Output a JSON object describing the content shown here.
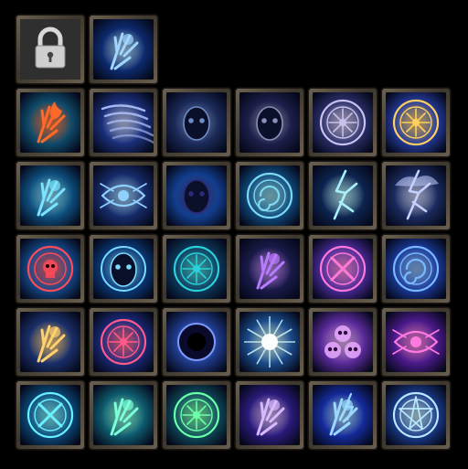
{
  "panel": "skill-icon-grid",
  "rows": [
    {
      "slots": [
        {
          "name": "skill-slot-locked",
          "icon": "padlock-icon",
          "state": "locked",
          "bg": "#3a3a3a",
          "glow": "#cfcfcf"
        },
        {
          "name": "skill-slot-summon-spirit",
          "icon": "glowing-hand-spirit-icon",
          "state": "unlocked",
          "bg": "#0d2a6e",
          "glow": "#9fd6ff"
        }
      ]
    },
    {
      "slots": [
        {
          "name": "skill-slot-fire-hand",
          "icon": "fire-in-hand-icon",
          "bg": "#0f4a6a",
          "glow": "#ff6a2a"
        },
        {
          "name": "skill-slot-whirlwind",
          "icon": "whirlwind-icon",
          "bg": "#1a2f7a",
          "glow": "#b7c8ff"
        },
        {
          "name": "skill-slot-dark-spirit",
          "icon": "dark-spirit-face-icon",
          "bg": "#1b2a5a",
          "glow": "#6d8cc8"
        },
        {
          "name": "skill-slot-shadow-knight",
          "icon": "shadow-knight-icon",
          "bg": "#1c1f4a",
          "glow": "#8a8fb8"
        },
        {
          "name": "skill-slot-spirit-rune",
          "icon": "spirit-rune-circle-icon",
          "bg": "#2a2f6a",
          "glow": "#c9c2ee"
        },
        {
          "name": "skill-slot-golden-sigil",
          "icon": "golden-sigil-icon",
          "bg": "#243a9a",
          "glow": "#ffd060"
        }
      ]
    },
    {
      "slots": [
        {
          "name": "skill-slot-ice-claw",
          "icon": "ice-claw-icon",
          "bg": "#0e4f7e",
          "glow": "#7be3ff"
        },
        {
          "name": "skill-slot-spirit-mage",
          "icon": "glowing-eyes-mage-icon",
          "bg": "#162b6b",
          "glow": "#8fd0ff"
        },
        {
          "name": "skill-slot-insect-totem",
          "icon": "insect-totem-icon",
          "bg": "#123e8e",
          "glow": "#2a2a7a"
        },
        {
          "name": "skill-slot-spiral-seal",
          "icon": "spiral-seal-icon",
          "bg": "#0f4a7e",
          "glow": "#7ed8f0"
        },
        {
          "name": "skill-slot-lightning",
          "icon": "lightning-icon",
          "bg": "#0d2450",
          "glow": "#a9f0ff"
        },
        {
          "name": "skill-slot-storm-cloud",
          "icon": "storm-cloud-icon",
          "bg": "#1a2a5e",
          "glow": "#c5d0ff"
        }
      ]
    },
    {
      "slots": [
        {
          "name": "skill-slot-crimson-sigil",
          "icon": "crimson-skull-sigil-icon",
          "bg": "#144a8a",
          "glow": "#ff4a5a"
        },
        {
          "name": "skill-slot-spirit-dancer",
          "icon": "spirit-dancer-orb-icon",
          "bg": "#0a3a7a",
          "glow": "#7ad8ff"
        },
        {
          "name": "skill-slot-knot-seal",
          "icon": "knot-seal-icon",
          "bg": "#0d3a5e",
          "glow": "#2bd0d8"
        },
        {
          "name": "skill-slot-shadow-grasp",
          "icon": "shadow-grasp-icon",
          "bg": "#1a1a4a",
          "glow": "#b87aff"
        },
        {
          "name": "skill-slot-arcane-cross",
          "icon": "arcane-cross-circle-icon",
          "bg": "#4a2a9a",
          "glow": "#ff7ad8"
        },
        {
          "name": "skill-slot-vortex",
          "icon": "vortex-icon",
          "bg": "#1a3a9a",
          "glow": "#7ab8ff"
        }
      ]
    },
    {
      "slots": [
        {
          "name": "skill-slot-light-finger",
          "icon": "glowing-finger-icon",
          "bg": "#1a2f6a",
          "glow": "#ffd070"
        },
        {
          "name": "skill-slot-runic-circle",
          "icon": "runic-circle-icon",
          "bg": "#1a2a7a",
          "glow": "#ff5a8a"
        },
        {
          "name": "skill-slot-void-portal",
          "icon": "void-portal-icon",
          "bg": "#1e3a8a",
          "glow": "#7a9aff"
        },
        {
          "name": "skill-slot-starburst",
          "icon": "starburst-icon",
          "bg": "#1a4a8a",
          "glow": "#d8ffff"
        },
        {
          "name": "skill-slot-triple-skull",
          "icon": "triple-skull-icon",
          "bg": "#5a2a9a",
          "glow": "#e8a8ff"
        },
        {
          "name": "skill-slot-all-seeing-eye",
          "icon": "winged-eye-icon",
          "bg": "#4a1a8a",
          "glow": "#ff7ae0"
        }
      ]
    },
    {
      "slots": [
        {
          "name": "skill-slot-crossed-seal",
          "icon": "crossed-seal-icon",
          "bg": "#0a4a7a",
          "glow": "#6af0ff"
        },
        {
          "name": "skill-slot-spirit-palm",
          "icon": "spirit-palm-icon",
          "bg": "#0e5a6e",
          "glow": "#7affd8"
        },
        {
          "name": "skill-slot-jade-seal",
          "icon": "jade-seal-icon",
          "bg": "#0e4a5a",
          "glow": "#6affa8"
        },
        {
          "name": "skill-slot-mystic-hand",
          "icon": "mystic-hand-icon",
          "bg": "#2a1a7a",
          "glow": "#d8b8ff"
        },
        {
          "name": "skill-slot-thunder-fist",
          "icon": "thunder-fist-icon",
          "bg": "#142a9a",
          "glow": "#9ad8ff"
        },
        {
          "name": "skill-slot-star-pentagram",
          "icon": "star-pentagram-icon",
          "bg": "#1a3a8a",
          "glow": "#b8e8ff"
        }
      ]
    }
  ]
}
